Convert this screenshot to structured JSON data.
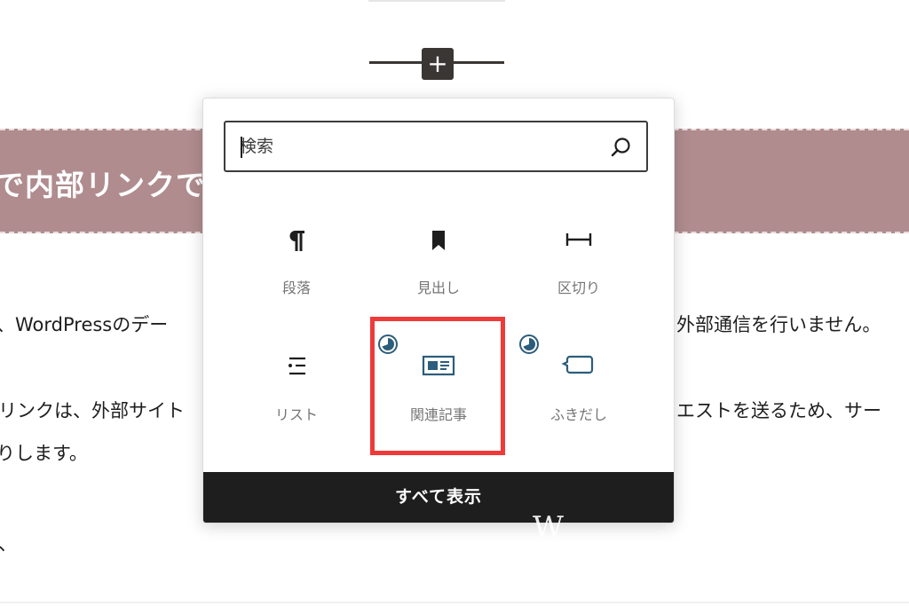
{
  "background": {
    "heading": "で内部リンクで",
    "paragraphs": [
      "、WordPressのデー",
      "外部通信を行いません。",
      "リンクは、外部サイト",
      "エストを送るため、サー",
      "りします。",
      "、"
    ]
  },
  "inserter": {
    "button_symbol": "+"
  },
  "popover": {
    "search": {
      "placeholder": "検索",
      "value": ""
    },
    "blocks": [
      {
        "label": "段落",
        "icon": "paragraph-icon",
        "recent": false
      },
      {
        "label": "見出し",
        "icon": "heading-icon",
        "recent": false
      },
      {
        "label": "区切り",
        "icon": "separator-icon",
        "recent": false
      },
      {
        "label": "リスト",
        "icon": "list-icon",
        "recent": false
      },
      {
        "label": "関連記事",
        "icon": "related-posts-icon",
        "recent": true,
        "highlighted": true
      },
      {
        "label": "ふきだし",
        "icon": "speech-bubble-icon",
        "recent": true
      }
    ],
    "show_all_label": "すべて表示"
  },
  "watermark": "W",
  "colors": {
    "heading_band": "#b08c8f",
    "highlight": "#ef3a3a",
    "block_icon_blue": "#2c5d7c",
    "show_all_bg": "#1e1e1e"
  }
}
